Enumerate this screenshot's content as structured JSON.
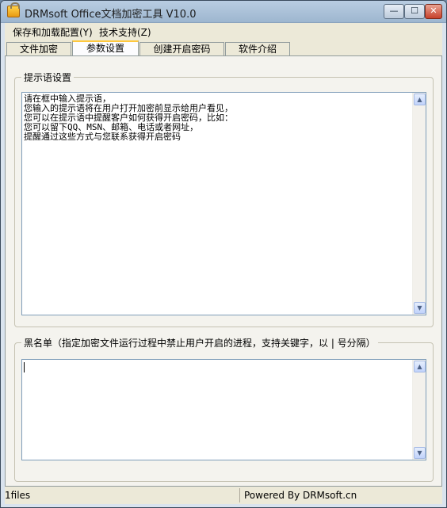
{
  "window": {
    "title": "DRMsoft Office文档加密工具 V10.0",
    "controls": {
      "minimize": "—",
      "maximize": "☐",
      "close": "✕"
    }
  },
  "menu": [
    "保存和加载配置(Y)",
    "技术支持(Z)"
  ],
  "tabs": [
    {
      "label": "文件加密",
      "active": false
    },
    {
      "label": "参数设置",
      "active": true
    },
    {
      "label": "创建开启密码",
      "active": false
    },
    {
      "label": "软件介绍",
      "active": false
    }
  ],
  "hint_group": {
    "legend": "提示语设置",
    "text": "请在框中输入提示语，\n您输入的提示语将在用户打开加密前显示给用户看见，\n您可以在提示语中提醒客户如何获得开启密码，比如：\n您可以留下QQ、MSN、邮箱、电话或者网址，\n提醒通过这些方式与您联系获得开启密码"
  },
  "blacklist_group": {
    "legend": "黑名单（指定加密文件运行过程中禁止用户开启的进程，支持关键字，以 | 号分隔）",
    "text": ""
  },
  "scroll_glyphs": {
    "up": "▲",
    "down": "▼"
  },
  "status": {
    "left": "1files",
    "right": "Powered By DRMsoft.cn"
  },
  "colors": {
    "accent_tab": "#ffc83c",
    "title_bar": "#9db6cf",
    "close_button": "#c7412b"
  }
}
